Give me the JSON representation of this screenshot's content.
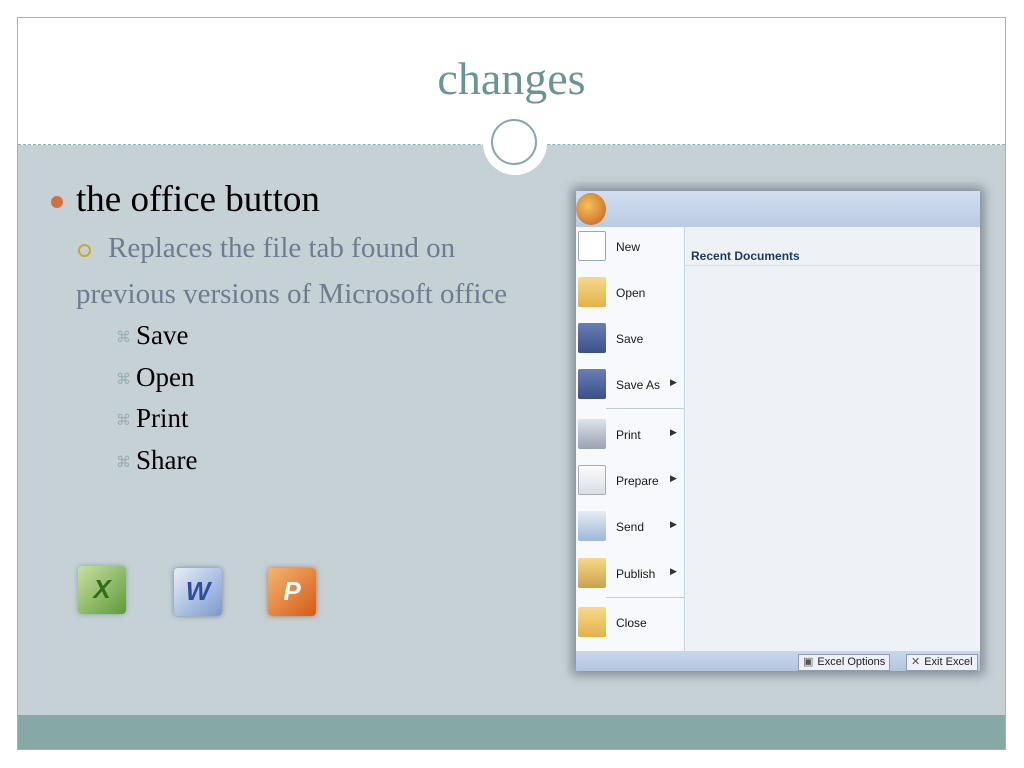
{
  "slide": {
    "title": "changes",
    "bullet_main": "the office button",
    "bullet_sub_line1": "Replaces the file tab found on",
    "bullet_sub_line2": "previous versions of Microsoft office",
    "items": [
      "Save",
      "Open",
      "Print",
      "Share"
    ],
    "sub_bullet_marker": "⌘"
  },
  "app_icons": [
    {
      "name": "excel-icon",
      "glyph": "X"
    },
    {
      "name": "word-icon",
      "glyph": "W"
    },
    {
      "name": "powerpoint-icon",
      "glyph": "P"
    }
  ],
  "office_menu": {
    "recent_documents_label": "Recent Documents",
    "items": [
      {
        "label": "New",
        "icon": "new-document-icon",
        "submenu": false
      },
      {
        "label": "Open",
        "icon": "open-folder-icon",
        "submenu": false
      },
      {
        "label": "Save",
        "icon": "save-icon",
        "submenu": false
      },
      {
        "label": "Save As",
        "icon": "save-as-icon",
        "submenu": true
      },
      {
        "label": "Print",
        "icon": "print-icon",
        "submenu": true
      },
      {
        "label": "Prepare",
        "icon": "prepare-icon",
        "submenu": true
      },
      {
        "label": "Send",
        "icon": "send-icon",
        "submenu": true
      },
      {
        "label": "Publish",
        "icon": "publish-icon",
        "submenu": true
      },
      {
        "label": "Close",
        "icon": "close-icon",
        "submenu": false
      }
    ],
    "excel_options_label": "Excel Options",
    "exit_excel_label": "Exit Excel"
  },
  "colors": {
    "title": "#6b9495",
    "bullet_dot": "#d5703e",
    "sub_bullet_ring": "#c9a92c",
    "sub_text": "#6f7c8e",
    "slide_bg": "#c6d1d6",
    "footer": "#86a8a7"
  }
}
